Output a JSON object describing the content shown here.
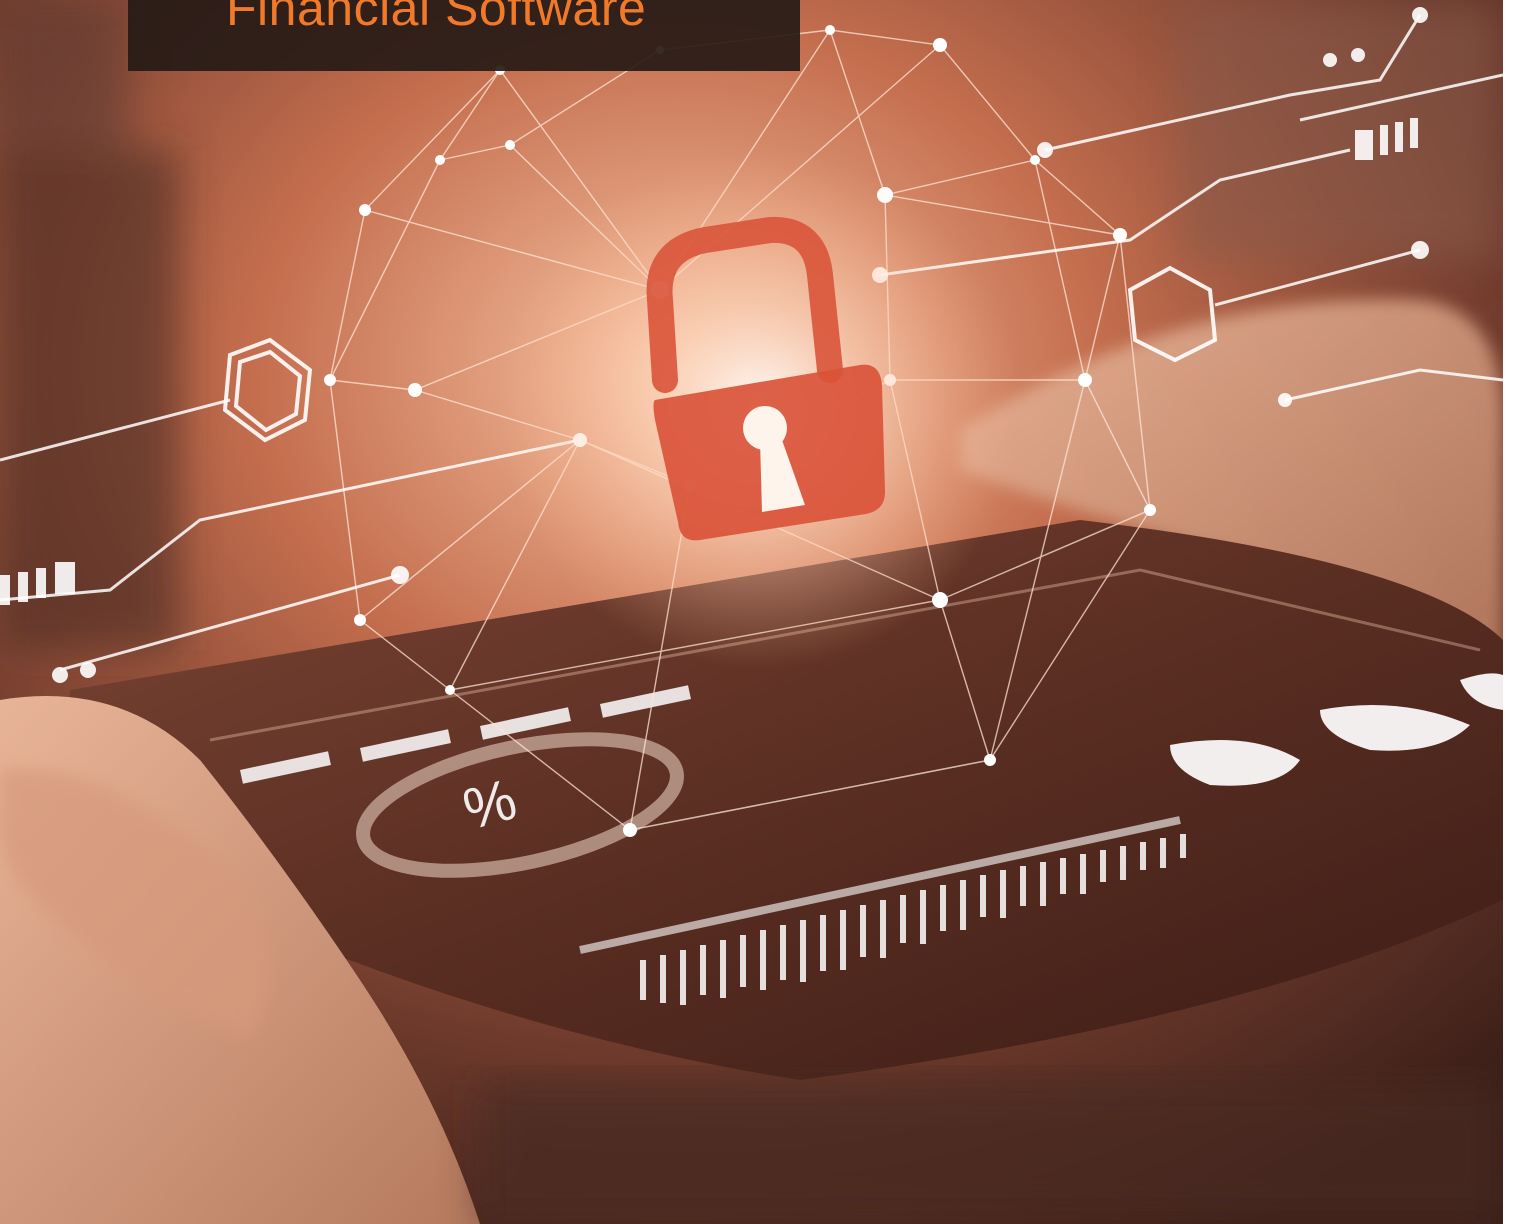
{
  "banner": {
    "title": "Financial Software",
    "title_color": "#f07a2a",
    "background_color": "#2a1c18"
  },
  "photo": {
    "subject": "hand holding smartphone with holographic padlock and network",
    "icons": [
      "padlock-icon",
      "percent-icon",
      "hexagon-icon"
    ],
    "screen_overlay": {
      "percent_symbol": "%"
    }
  },
  "colors": {
    "accent": "#f07a2a",
    "warm_glow": "#f4b08a",
    "shadow": "#3a2018"
  }
}
